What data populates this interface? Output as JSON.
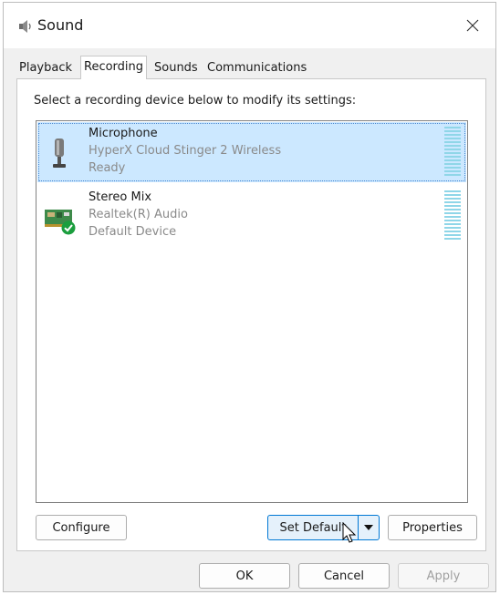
{
  "window": {
    "title": "Sound"
  },
  "tabs": [
    {
      "label": "Playback",
      "active": false
    },
    {
      "label": "Recording",
      "active": true
    },
    {
      "label": "Sounds",
      "active": false
    },
    {
      "label": "Communications",
      "active": false
    }
  ],
  "recording": {
    "instructions": "Select a recording device below to modify its settings:",
    "devices": [
      {
        "name": "Microphone",
        "description": "HyperX Cloud Stinger 2 Wireless",
        "status": "Ready",
        "icon": "microphone-icon",
        "selected": true
      },
      {
        "name": "Stereo Mix",
        "description": "Realtek(R) Audio",
        "status": "Default Device",
        "icon": "sound-card-icon",
        "badge": "default-check-icon",
        "selected": false
      }
    ]
  },
  "buttons": {
    "configure": "Configure",
    "set_default": "Set Default",
    "properties": "Properties",
    "ok": "OK",
    "cancel": "Cancel",
    "apply": "Apply"
  },
  "colors": {
    "selection": "#cce8ff",
    "meter": "#8fd6e8",
    "default_check": "#1b9e3e",
    "accent": "#0078d4"
  }
}
